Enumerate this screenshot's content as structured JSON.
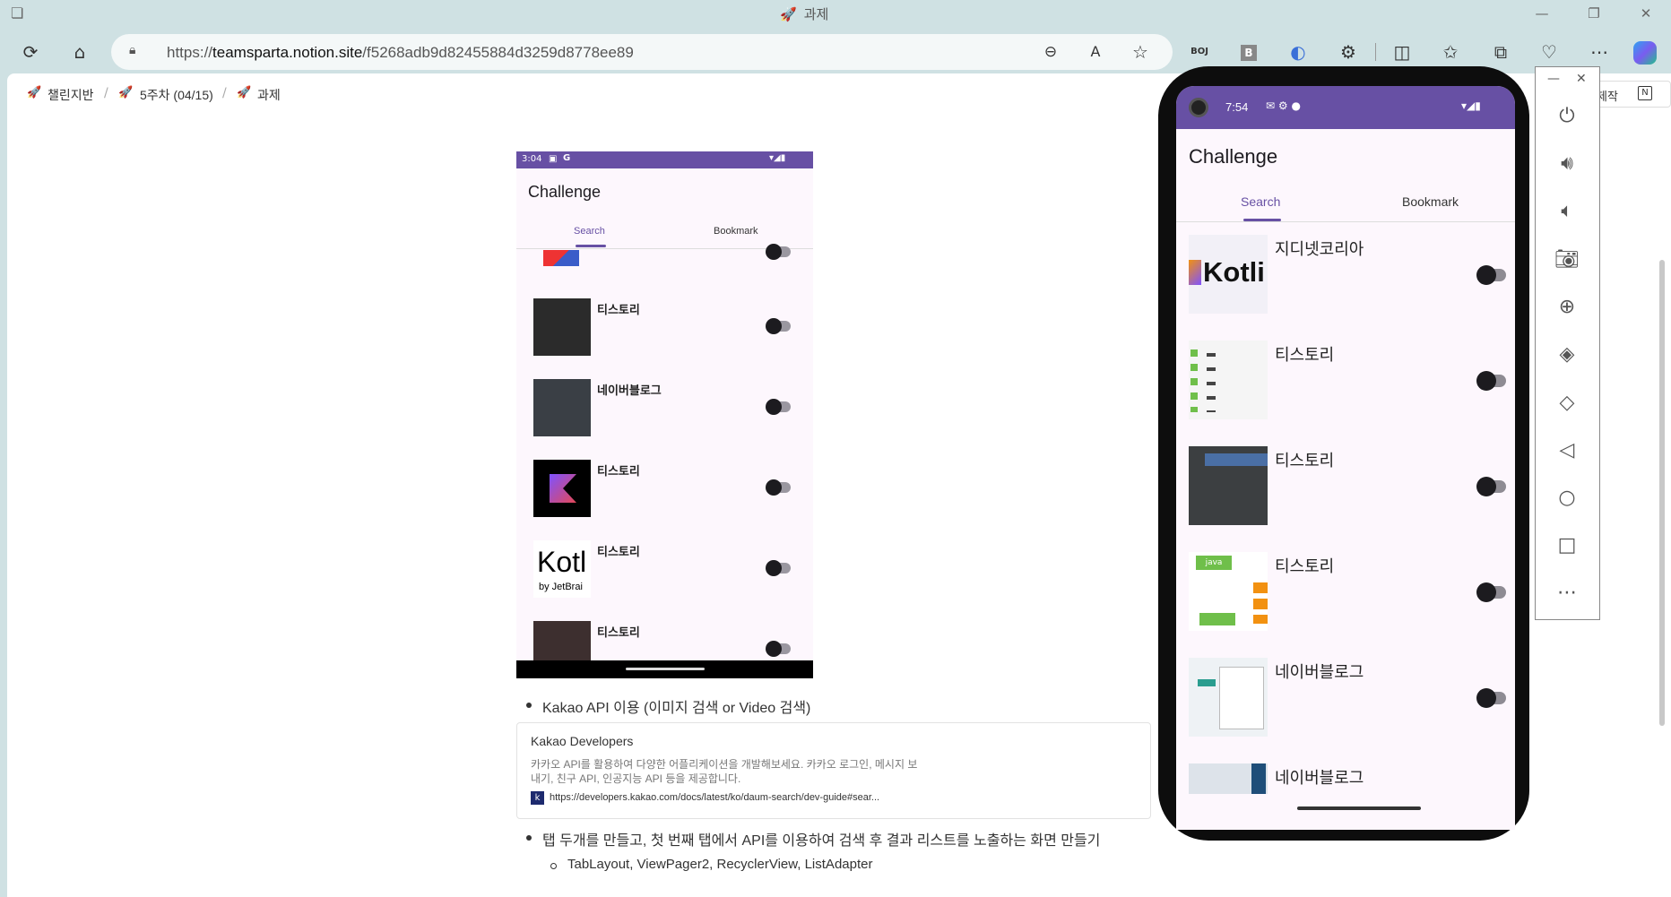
{
  "window": {
    "title": "과제",
    "controls": [
      "—",
      "❐",
      "✕"
    ]
  },
  "address_bar": {
    "url_prefix": "https://",
    "url_domain": "teamsparta.notion.site",
    "url_path": "/f5268adb9d82455884d3259d8778ee89"
  },
  "toolbar_icons": [
    "refresh-icon",
    "home-icon",
    "lock-icon",
    "zoom-out-icon",
    "read-aloud-icon",
    "favorite-star-icon",
    "boj-extension",
    "b-extension",
    "extension-c",
    "extensions-icon",
    "split-screen-icon",
    "favorites-icon",
    "collections-icon",
    "performance-icon",
    "more-icon",
    "copilot-icon"
  ],
  "toolbar_labels": {
    "boj": "BOJ",
    "b": "B"
  },
  "breadcrumb": [
    {
      "label": "챌린지반"
    },
    {
      "label": "5주차 (04/15)"
    },
    {
      "label": "과제"
    }
  ],
  "share_chip": {
    "label": "제작"
  },
  "embedded_shot": {
    "time": "3:04",
    "app_title": "Challenge",
    "tabs": [
      "Search",
      "Bookmark"
    ],
    "items": [
      {
        "label": "티스토리"
      },
      {
        "label": "네이버블로그"
      },
      {
        "label": "티스토리"
      },
      {
        "label": "티스토리",
        "thumb_text": "Kotl",
        "thumb_sub": "by JetBrai"
      },
      {
        "label": "티스토리"
      }
    ]
  },
  "content": {
    "bullet1": "Kakao API 이용 (이미지 검색 or Video 검색)",
    "bookmark": {
      "title": "Kakao Developers",
      "desc": "카카오 API를 활용하여 다양한 어플리케이션을 개발해보세요. 카카오 로그인, 메시지 보내기, 친구 API, 인공지능 API 등을 제공합니다.",
      "favicon": "k",
      "url": "https://developers.kakao.com/docs/latest/ko/daum-search/dev-guide#sear..."
    },
    "bullet2": "탭 두개를 만들고, 첫 번째 탭에서 API를 이용하여 검색 후 결과 리스트를 노출하는 화면 만들기",
    "sub_bullet": "TabLayout, ViewPager2, RecyclerView, ListAdapter"
  },
  "emulator": {
    "time": "7:54",
    "app_title": "Challenge",
    "tabs": [
      "Search",
      "Bookmark"
    ],
    "items": [
      {
        "label": "지디넷코리아",
        "thumb_text": "Kotli"
      },
      {
        "label": "티스토리"
      },
      {
        "label": "티스토리"
      },
      {
        "label": "티스토리",
        "thumb_text": "java"
      },
      {
        "label": "네이버블로그"
      },
      {
        "label": "네이버블로그"
      }
    ],
    "side_buttons": [
      "power-icon",
      "volume-up-icon",
      "volume-down-icon",
      "camera-icon",
      "zoom-icon",
      "rotate-left-icon",
      "rotate-right-icon",
      "back-icon",
      "home-circle-icon",
      "overview-icon",
      "more-icon"
    ]
  },
  "colors": {
    "accent": "#6750a4",
    "frame_bg": "#cfe1e3",
    "app_bg": "#fdf7fd"
  }
}
